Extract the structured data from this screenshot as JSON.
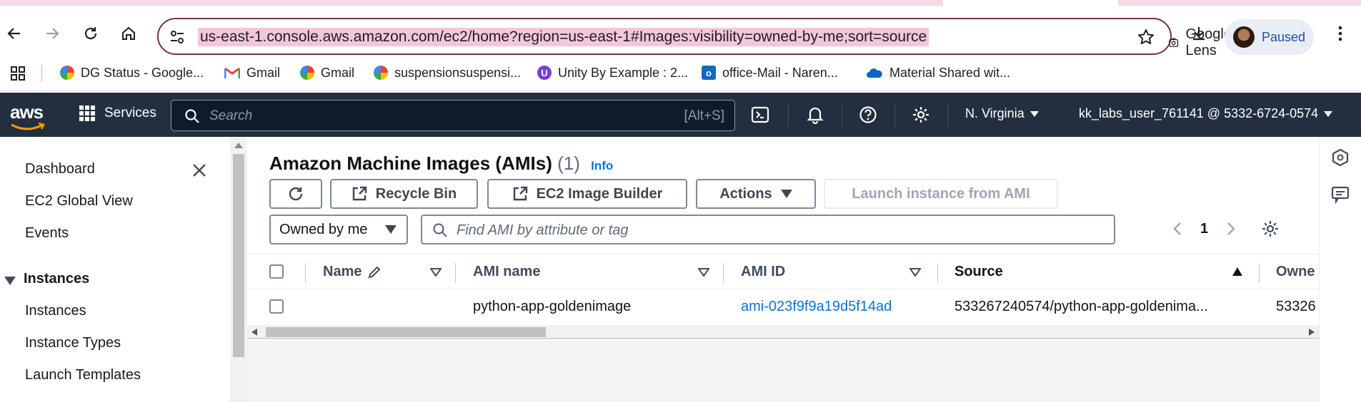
{
  "browser": {
    "url": "us-east-1.console.aws.amazon.com/ec2/home?region=us-east-1#Images:visibility=owned-by-me;sort=source",
    "lens_label": "Google Lens",
    "profile_status": "Paused",
    "accent_color": "#7a2b52"
  },
  "bookmarks": [
    {
      "label": "DG Status - Google...",
      "icon": "google-icon"
    },
    {
      "label": "Gmail",
      "icon": "gmail-icon"
    },
    {
      "label": "Gmail",
      "icon": "google-icon"
    },
    {
      "label": "suspensionsuspensi...",
      "icon": "google-icon"
    },
    {
      "label": "Unity By Example : 2...",
      "icon": "purple-u-icon"
    },
    {
      "label": "office-Mail - Naren...",
      "icon": "outlook-icon"
    },
    {
      "label": "Material Shared wit...",
      "icon": "onedrive-icon"
    }
  ],
  "aws_header": {
    "logo": "aws",
    "services_label": "Services",
    "search_placeholder": "Search",
    "search_shortcut": "[Alt+S]",
    "region": "N. Virginia",
    "account": "kk_labs_user_761141 @ 5332-6724-0574",
    "bg_color": "#232f3e"
  },
  "left_nav": {
    "items": [
      "Dashboard",
      "EC2 Global View",
      "Events"
    ],
    "section": "Instances",
    "section_items": [
      "Instances",
      "Instance Types",
      "Launch Templates"
    ]
  },
  "main": {
    "title": "Amazon Machine Images (AMIs)",
    "count": "(1)",
    "info": "Info",
    "buttons": {
      "recycle_bin": "Recycle Bin",
      "image_builder": "EC2 Image Builder",
      "actions": "Actions",
      "launch": "Launch instance from AMI"
    },
    "owner_filter": "Owned by me",
    "filter_placeholder": "Find AMI by attribute or tag",
    "page": "1"
  },
  "table": {
    "columns": [
      "Name",
      "AMI name",
      "AMI ID",
      "Source",
      "Owne"
    ],
    "rows": [
      {
        "name": "",
        "ami_name": "python-app-goldenimage",
        "ami_id": "ami-023f9f9a19d5f14ad",
        "source": "533267240574/python-app-goldenima...",
        "owner": "53326"
      }
    ]
  }
}
